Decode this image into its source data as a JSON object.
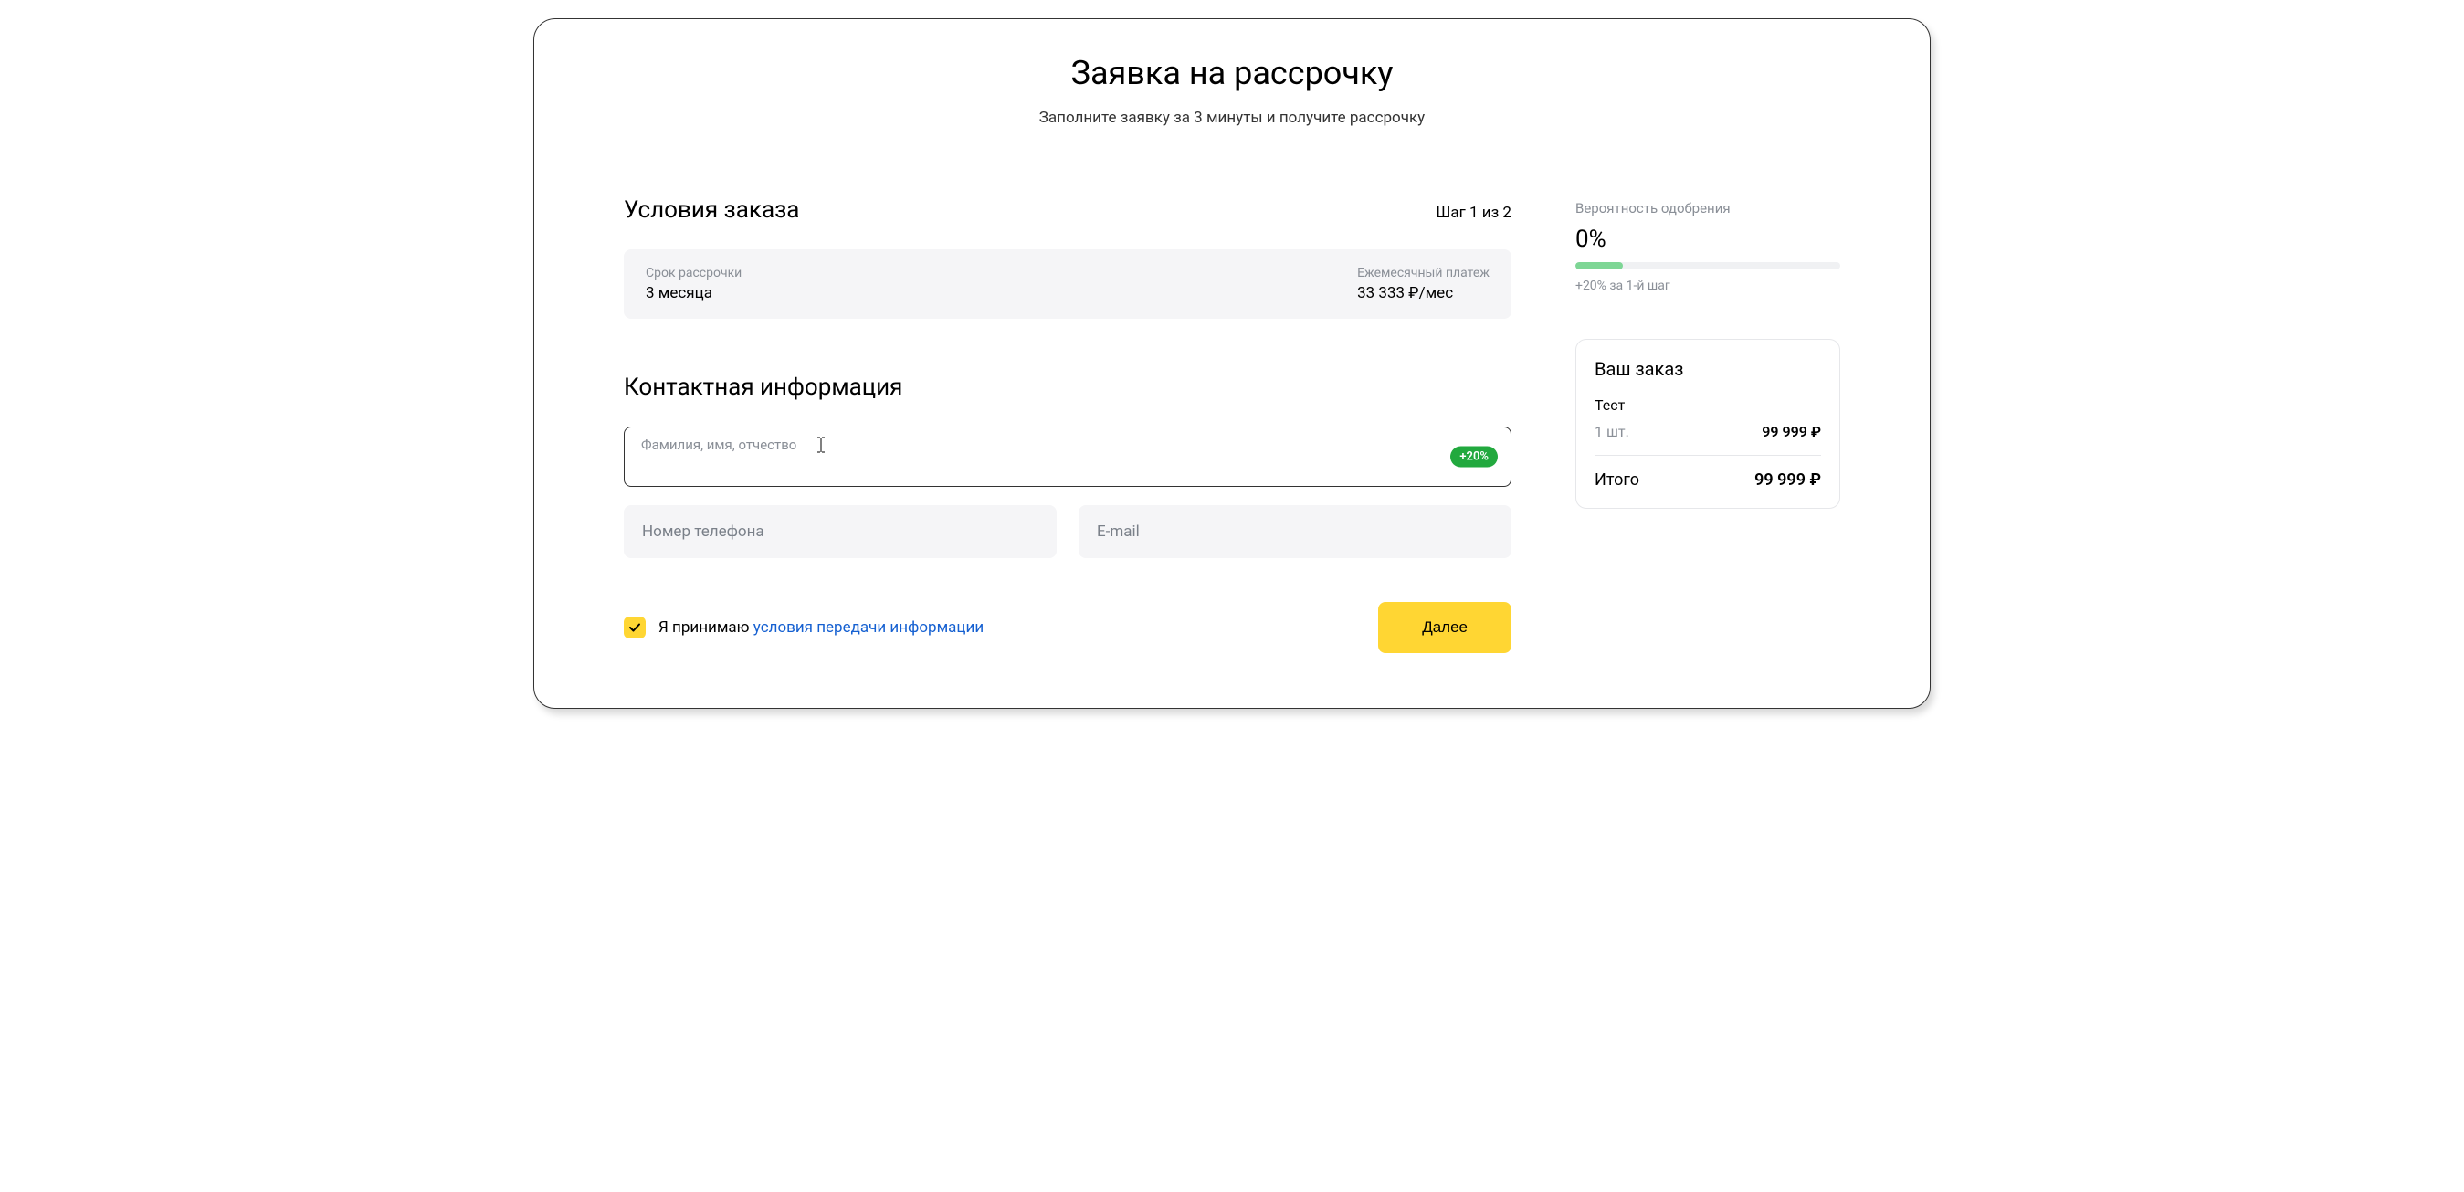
{
  "header": {
    "title": "Заявка на рассрочку",
    "subtitle": "Заполните заявку за 3 минуты и получите рассрочку"
  },
  "section": {
    "title": "Условия заказа",
    "step": "Шаг 1 из 2"
  },
  "terms": {
    "duration_label": "Срок рассрочки",
    "duration_value": "3 месяца",
    "payment_label": "Ежемесячный платеж",
    "payment_value": "33 333 ₽/мес"
  },
  "contact": {
    "title": "Контактная информация",
    "fullname_label": "Фамилия, имя, отчество",
    "fullname_value": "",
    "fullname_badge": "+20%",
    "phone_placeholder": "Номер телефона",
    "email_placeholder": "E-mail"
  },
  "consent": {
    "prefix": "Я принимаю ",
    "link": "условия передачи информации",
    "checked": true
  },
  "actions": {
    "next": "Далее"
  },
  "approval": {
    "label": "Вероятность одобрения",
    "value": "0%",
    "fill_percent": 18,
    "hint": "+20% за 1-й шаг"
  },
  "order": {
    "title": "Ваш заказ",
    "item_name": "Тест",
    "item_qty": "1 шт.",
    "item_price": "99 999 ₽",
    "total_label": "Итого",
    "total_value": "99 999 ₽"
  }
}
